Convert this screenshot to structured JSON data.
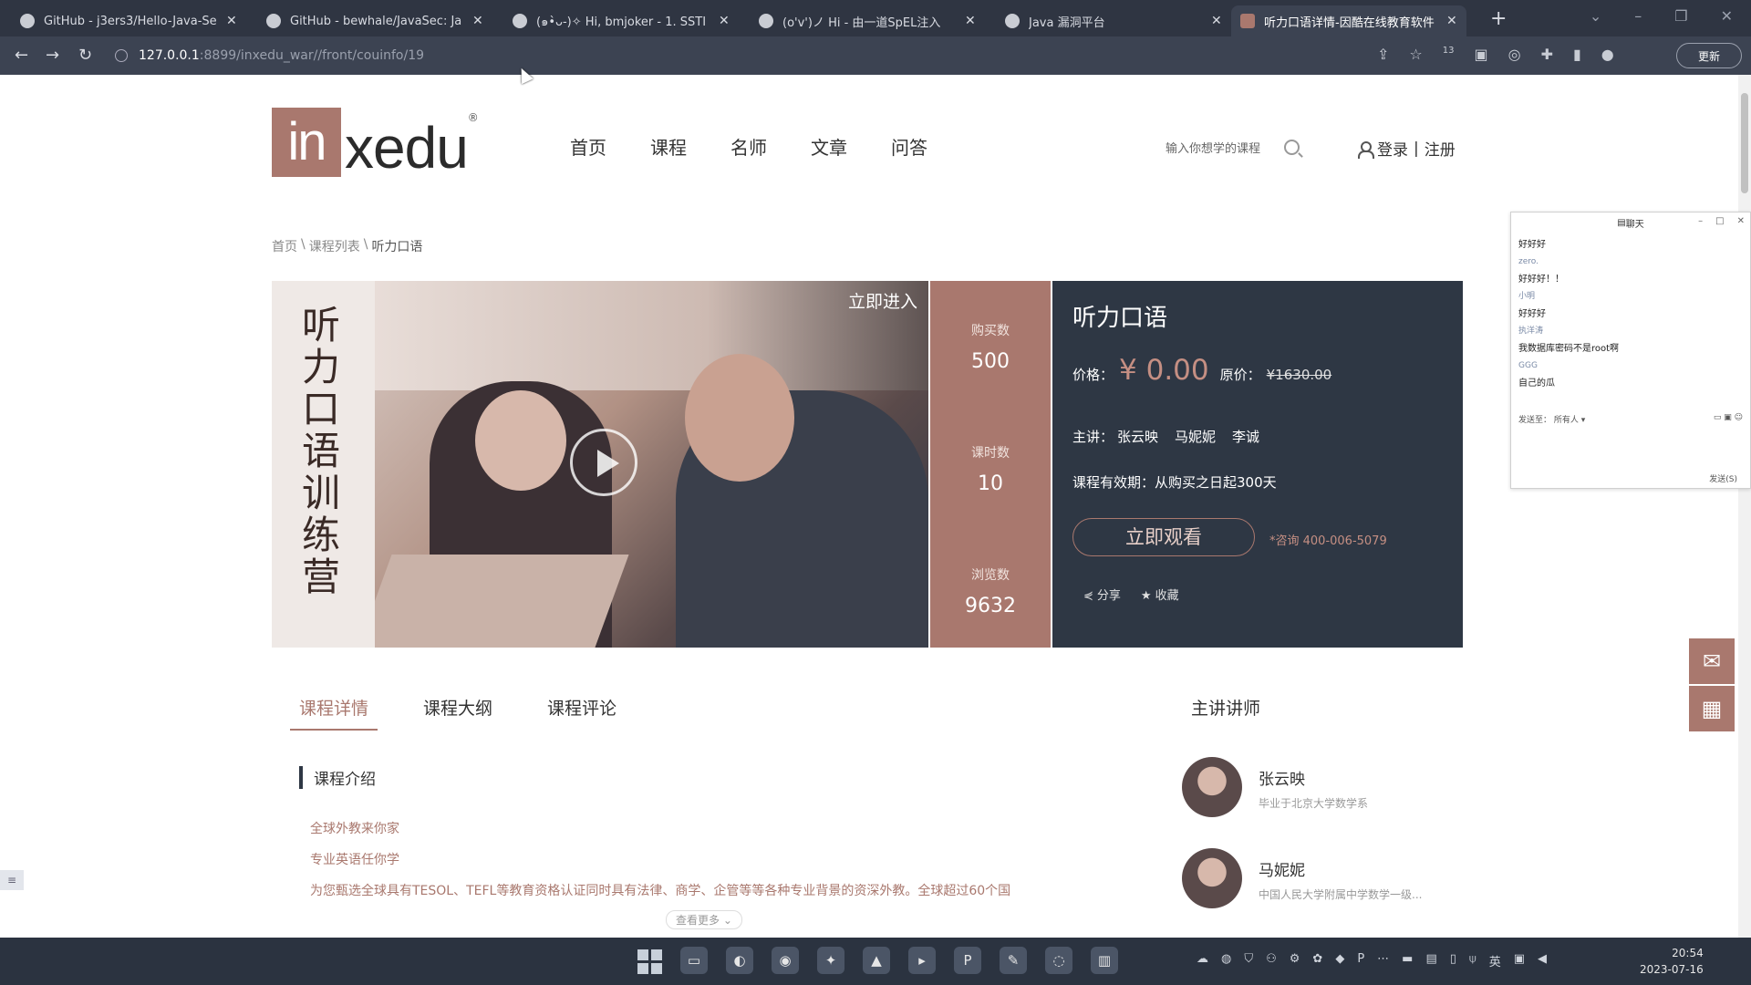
{
  "browser": {
    "tabs": [
      {
        "title": "GitHub - j3ers3/Hello-Java-Se",
        "icon": "github-icon"
      },
      {
        "title": "GitHub - bewhale/JavaSec: Ja",
        "icon": "github-icon"
      },
      {
        "title": "(๑•̀ᴗ-)✧ Hi, bmjoker - 1. SSTI",
        "icon": "blog-icon"
      },
      {
        "title": "(o'v')ノ Hi - 由一道SpEL注入",
        "icon": "blog-icon"
      },
      {
        "title": "Java 漏洞平台",
        "icon": "globe-icon"
      },
      {
        "title": "听力口语详情-因酷在线教育软件",
        "icon": "inxedu-icon"
      }
    ],
    "url_host": "127.0.0.1",
    "url_path": ":8899/inxedu_war//front/couinfo/19",
    "update_label": "更新",
    "extension_badge": "13"
  },
  "site": {
    "logo_box": "in",
    "logo_rest": "xedu",
    "logo_reg": "®",
    "nav": [
      "首页",
      "课程",
      "名师",
      "文章",
      "问答"
    ],
    "search_placeholder": "输入你想学的课程",
    "login": "登录",
    "separator": "|",
    "register": "注册"
  },
  "breadcrumb": [
    "首页",
    "课程列表",
    "听力口语"
  ],
  "breadcrumb_sep": "\\",
  "hero": {
    "vertical_title": "听力口语训练营",
    "enter_now": "立即进入",
    "stats": [
      {
        "label": "购买数",
        "value": "500"
      },
      {
        "label": "课时数",
        "value": "10"
      },
      {
        "label": "浏览数",
        "value": "9632"
      }
    ],
    "course_title": "听力口语",
    "price_label": "价格：",
    "price_now": "¥ 0.00",
    "price_orig_label": "原价：",
    "price_orig": "¥1630.00",
    "teachers_label": "主讲：",
    "teachers": [
      "张云映",
      "马妮妮",
      "李诚"
    ],
    "valid_label": "课程有效期：",
    "valid_value": "从购买之日起300天",
    "watch_button": "立即观看",
    "consult": "*咨询 400-006-5079",
    "share": "分享",
    "favorite": "收藏"
  },
  "details": {
    "tabs": [
      "课程详情",
      "课程大纲",
      "课程评论"
    ],
    "section_title": "课程介绍",
    "intro_lines": [
      "全球外教来你家",
      "专业英语任你学",
      "为您甄选全球具有TESOL、TEFL等教育资格认证同时具有法律、商学、企管等等各种专业背景的资深外教。全球超过60个国"
    ],
    "more": "查看更多"
  },
  "lecturers": {
    "title": "主讲讲师",
    "items": [
      {
        "name": "张云映",
        "desc": "毕业于北京大学数学系"
      },
      {
        "name": "马妮妮",
        "desc": "中国人民大学附属中学数学一级..."
      }
    ]
  },
  "chat": {
    "title": "聊天",
    "messages": [
      {
        "text": "好好好",
        "sender": false
      },
      {
        "text": "zero.",
        "sender": true
      },
      {
        "text": "好好好！！",
        "sender": false
      },
      {
        "text": "小明",
        "sender": true
      },
      {
        "text": "好好好",
        "sender": false
      },
      {
        "text": "执洋涛",
        "sender": true
      },
      {
        "text": "我数据库密码不是root啊",
        "sender": false
      },
      {
        "text": "GGG",
        "sender": true
      },
      {
        "text": "自己的瓜",
        "sender": false
      }
    ],
    "send_to_label": "发送至：",
    "send_to_value": "所有人",
    "send_button": "发送(S)"
  },
  "taskbar": {
    "time": "20:54",
    "date": "2023-07-16",
    "ime": "英"
  }
}
